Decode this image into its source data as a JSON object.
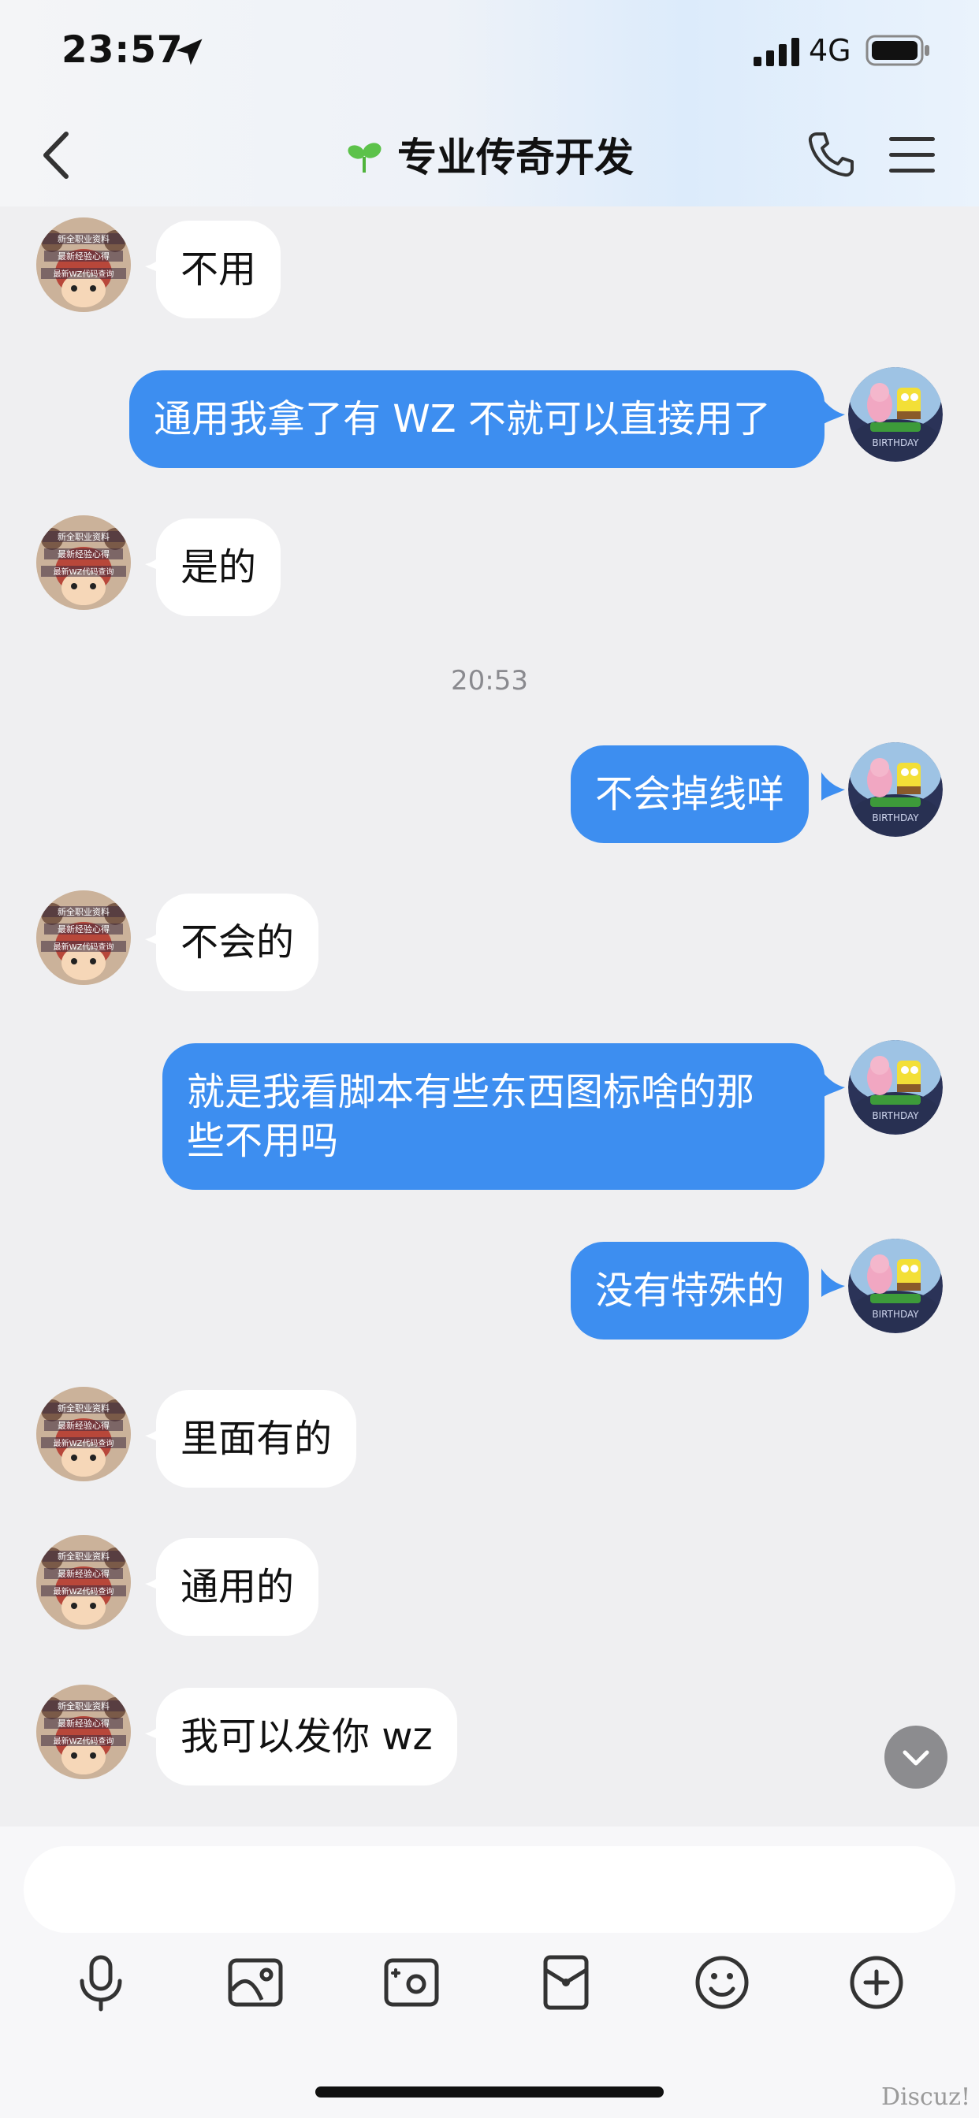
{
  "status_bar": {
    "time": "23:57",
    "network": "4G"
  },
  "header": {
    "title": "专业传奇开发"
  },
  "messages": [
    {
      "side": "in",
      "text": "不用"
    },
    {
      "side": "out",
      "text": "通用我拿了有 WZ 不就可以直接用了"
    },
    {
      "side": "in",
      "text": "是的"
    },
    {
      "type": "time",
      "text": "20:53"
    },
    {
      "side": "out",
      "text": "不会掉线咩"
    },
    {
      "side": "in",
      "text": "不会的"
    },
    {
      "side": "out",
      "text": "就是我看脚本有些东西图标啥的那\n些不用吗"
    },
    {
      "side": "out",
      "text": "没有特殊的"
    },
    {
      "side": "in",
      "text": "里面有的"
    },
    {
      "side": "in",
      "text": "通用的"
    },
    {
      "side": "in",
      "text": "我可以发你 wz"
    }
  ],
  "avatars": {
    "contact": {
      "badge_lines": [
        "新全职业资料",
        "最新经验心得",
        "最新WZ代码查询"
      ]
    },
    "self": {
      "badge_text": "BIRTHDAY"
    }
  },
  "input": {
    "placeholder": ""
  },
  "toolbar": {
    "icons": [
      "microphone-icon",
      "image-icon",
      "camera-icon",
      "red-packet-icon",
      "emoji-icon",
      "plus-icon"
    ]
  },
  "watermark": "Discuz!",
  "colors": {
    "outgoing_bubble": "#3d8ef0",
    "incoming_bubble": "#ffffff",
    "background": "#efeff1"
  }
}
